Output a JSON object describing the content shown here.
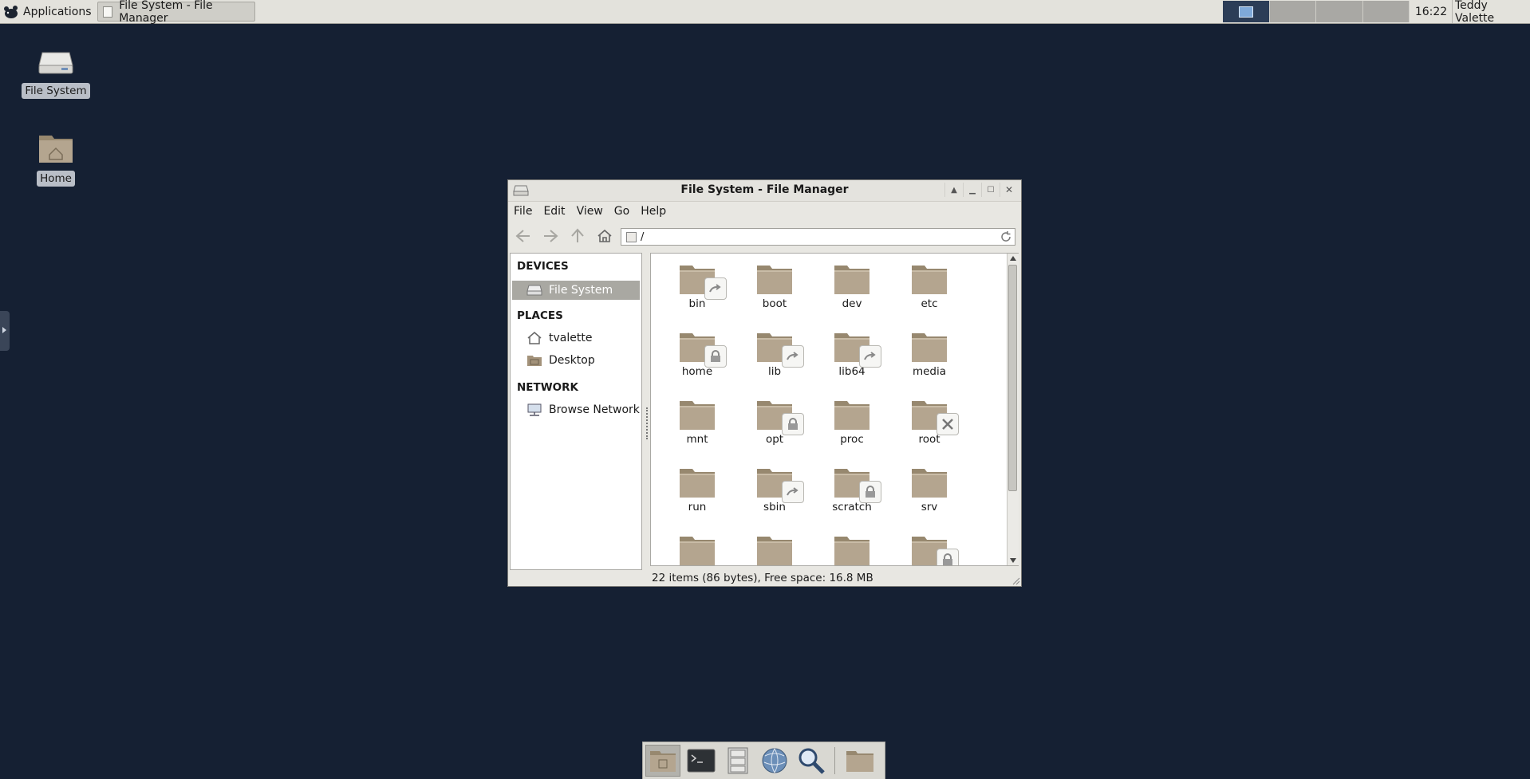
{
  "panel": {
    "applications_label": "Applications",
    "task_label": "File System - File Manager",
    "clock": "16:22",
    "user": "Teddy Valette"
  },
  "desktop": {
    "icons": [
      {
        "label": "File System",
        "icon": "drive-icon"
      },
      {
        "label": "Home",
        "icon": "home-folder-icon"
      }
    ]
  },
  "window": {
    "title": "File System - File Manager",
    "menus": [
      "File",
      "Edit",
      "View",
      "Go",
      "Help"
    ],
    "toolbar": {
      "back": "back-arrow-icon",
      "forward": "forward-arrow-icon",
      "up": "up-arrow-icon",
      "home": "home-icon",
      "reload": "reload-icon"
    },
    "path": "/",
    "sidebar": {
      "devices_heading": "DEVICES",
      "devices": [
        {
          "label": "File System",
          "selected": true
        }
      ],
      "places_heading": "PLACES",
      "places": [
        {
          "label": "tvalette"
        },
        {
          "label": "Desktop"
        }
      ],
      "network_heading": "NETWORK",
      "network": [
        {
          "label": "Browse Network"
        }
      ]
    },
    "files": [
      {
        "name": "bin",
        "emblem": "link"
      },
      {
        "name": "boot",
        "emblem": ""
      },
      {
        "name": "dev",
        "emblem": ""
      },
      {
        "name": "etc",
        "emblem": ""
      },
      {
        "name": "home",
        "emblem": "lock"
      },
      {
        "name": "lib",
        "emblem": "link"
      },
      {
        "name": "lib64",
        "emblem": "link"
      },
      {
        "name": "media",
        "emblem": ""
      },
      {
        "name": "mnt",
        "emblem": ""
      },
      {
        "name": "opt",
        "emblem": "lock"
      },
      {
        "name": "proc",
        "emblem": ""
      },
      {
        "name": "root",
        "emblem": "unreadable"
      },
      {
        "name": "run",
        "emblem": ""
      },
      {
        "name": "sbin",
        "emblem": "link"
      },
      {
        "name": "scratch",
        "emblem": "lock"
      },
      {
        "name": "srv",
        "emblem": ""
      },
      {
        "name": "",
        "emblem": ""
      },
      {
        "name": "",
        "emblem": ""
      },
      {
        "name": "",
        "emblem": ""
      },
      {
        "name": "",
        "emblem": "lock"
      }
    ],
    "status": "22 items (86 bytes), Free space: 16.8 MB"
  },
  "colors": {
    "desktop_bg": "#152033",
    "folder": "#b4a58f",
    "folder_dark": "#97886f",
    "selection": "#a9a8a2"
  },
  "dock": {
    "items": [
      "file-manager-icon",
      "terminal-icon",
      "file-cabinet-icon",
      "web-browser-icon",
      "search-icon",
      "folder-icon"
    ]
  }
}
